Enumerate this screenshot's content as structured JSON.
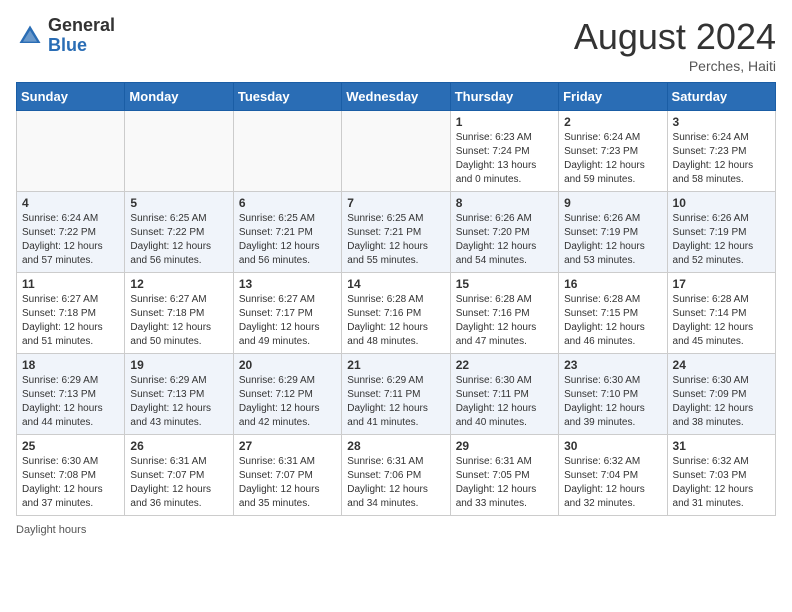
{
  "header": {
    "logo_general": "General",
    "logo_blue": "Blue",
    "month_year": "August 2024",
    "location": "Perches, Haiti"
  },
  "weekdays": [
    "Sunday",
    "Monday",
    "Tuesday",
    "Wednesday",
    "Thursday",
    "Friday",
    "Saturday"
  ],
  "footer": {
    "daylight_label": "Daylight hours"
  },
  "weeks": [
    {
      "days": [
        {
          "num": "",
          "info": "",
          "empty": true
        },
        {
          "num": "",
          "info": "",
          "empty": true
        },
        {
          "num": "",
          "info": "",
          "empty": true
        },
        {
          "num": "",
          "info": "",
          "empty": true
        },
        {
          "num": "1",
          "info": "Sunrise: 6:23 AM\nSunset: 7:24 PM\nDaylight: 13 hours\nand 0 minutes.",
          "empty": false
        },
        {
          "num": "2",
          "info": "Sunrise: 6:24 AM\nSunset: 7:23 PM\nDaylight: 12 hours\nand 59 minutes.",
          "empty": false
        },
        {
          "num": "3",
          "info": "Sunrise: 6:24 AM\nSunset: 7:23 PM\nDaylight: 12 hours\nand 58 minutes.",
          "empty": false
        }
      ]
    },
    {
      "days": [
        {
          "num": "4",
          "info": "Sunrise: 6:24 AM\nSunset: 7:22 PM\nDaylight: 12 hours\nand 57 minutes.",
          "empty": false
        },
        {
          "num": "5",
          "info": "Sunrise: 6:25 AM\nSunset: 7:22 PM\nDaylight: 12 hours\nand 56 minutes.",
          "empty": false
        },
        {
          "num": "6",
          "info": "Sunrise: 6:25 AM\nSunset: 7:21 PM\nDaylight: 12 hours\nand 56 minutes.",
          "empty": false
        },
        {
          "num": "7",
          "info": "Sunrise: 6:25 AM\nSunset: 7:21 PM\nDaylight: 12 hours\nand 55 minutes.",
          "empty": false
        },
        {
          "num": "8",
          "info": "Sunrise: 6:26 AM\nSunset: 7:20 PM\nDaylight: 12 hours\nand 54 minutes.",
          "empty": false
        },
        {
          "num": "9",
          "info": "Sunrise: 6:26 AM\nSunset: 7:19 PM\nDaylight: 12 hours\nand 53 minutes.",
          "empty": false
        },
        {
          "num": "10",
          "info": "Sunrise: 6:26 AM\nSunset: 7:19 PM\nDaylight: 12 hours\nand 52 minutes.",
          "empty": false
        }
      ]
    },
    {
      "days": [
        {
          "num": "11",
          "info": "Sunrise: 6:27 AM\nSunset: 7:18 PM\nDaylight: 12 hours\nand 51 minutes.",
          "empty": false
        },
        {
          "num": "12",
          "info": "Sunrise: 6:27 AM\nSunset: 7:18 PM\nDaylight: 12 hours\nand 50 minutes.",
          "empty": false
        },
        {
          "num": "13",
          "info": "Sunrise: 6:27 AM\nSunset: 7:17 PM\nDaylight: 12 hours\nand 49 minutes.",
          "empty": false
        },
        {
          "num": "14",
          "info": "Sunrise: 6:28 AM\nSunset: 7:16 PM\nDaylight: 12 hours\nand 48 minutes.",
          "empty": false
        },
        {
          "num": "15",
          "info": "Sunrise: 6:28 AM\nSunset: 7:16 PM\nDaylight: 12 hours\nand 47 minutes.",
          "empty": false
        },
        {
          "num": "16",
          "info": "Sunrise: 6:28 AM\nSunset: 7:15 PM\nDaylight: 12 hours\nand 46 minutes.",
          "empty": false
        },
        {
          "num": "17",
          "info": "Sunrise: 6:28 AM\nSunset: 7:14 PM\nDaylight: 12 hours\nand 45 minutes.",
          "empty": false
        }
      ]
    },
    {
      "days": [
        {
          "num": "18",
          "info": "Sunrise: 6:29 AM\nSunset: 7:13 PM\nDaylight: 12 hours\nand 44 minutes.",
          "empty": false
        },
        {
          "num": "19",
          "info": "Sunrise: 6:29 AM\nSunset: 7:13 PM\nDaylight: 12 hours\nand 43 minutes.",
          "empty": false
        },
        {
          "num": "20",
          "info": "Sunrise: 6:29 AM\nSunset: 7:12 PM\nDaylight: 12 hours\nand 42 minutes.",
          "empty": false
        },
        {
          "num": "21",
          "info": "Sunrise: 6:29 AM\nSunset: 7:11 PM\nDaylight: 12 hours\nand 41 minutes.",
          "empty": false
        },
        {
          "num": "22",
          "info": "Sunrise: 6:30 AM\nSunset: 7:11 PM\nDaylight: 12 hours\nand 40 minutes.",
          "empty": false
        },
        {
          "num": "23",
          "info": "Sunrise: 6:30 AM\nSunset: 7:10 PM\nDaylight: 12 hours\nand 39 minutes.",
          "empty": false
        },
        {
          "num": "24",
          "info": "Sunrise: 6:30 AM\nSunset: 7:09 PM\nDaylight: 12 hours\nand 38 minutes.",
          "empty": false
        }
      ]
    },
    {
      "days": [
        {
          "num": "25",
          "info": "Sunrise: 6:30 AM\nSunset: 7:08 PM\nDaylight: 12 hours\nand 37 minutes.",
          "empty": false
        },
        {
          "num": "26",
          "info": "Sunrise: 6:31 AM\nSunset: 7:07 PM\nDaylight: 12 hours\nand 36 minutes.",
          "empty": false
        },
        {
          "num": "27",
          "info": "Sunrise: 6:31 AM\nSunset: 7:07 PM\nDaylight: 12 hours\nand 35 minutes.",
          "empty": false
        },
        {
          "num": "28",
          "info": "Sunrise: 6:31 AM\nSunset: 7:06 PM\nDaylight: 12 hours\nand 34 minutes.",
          "empty": false
        },
        {
          "num": "29",
          "info": "Sunrise: 6:31 AM\nSunset: 7:05 PM\nDaylight: 12 hours\nand 33 minutes.",
          "empty": false
        },
        {
          "num": "30",
          "info": "Sunrise: 6:32 AM\nSunset: 7:04 PM\nDaylight: 12 hours\nand 32 minutes.",
          "empty": false
        },
        {
          "num": "31",
          "info": "Sunrise: 6:32 AM\nSunset: 7:03 PM\nDaylight: 12 hours\nand 31 minutes.",
          "empty": false
        }
      ]
    }
  ]
}
